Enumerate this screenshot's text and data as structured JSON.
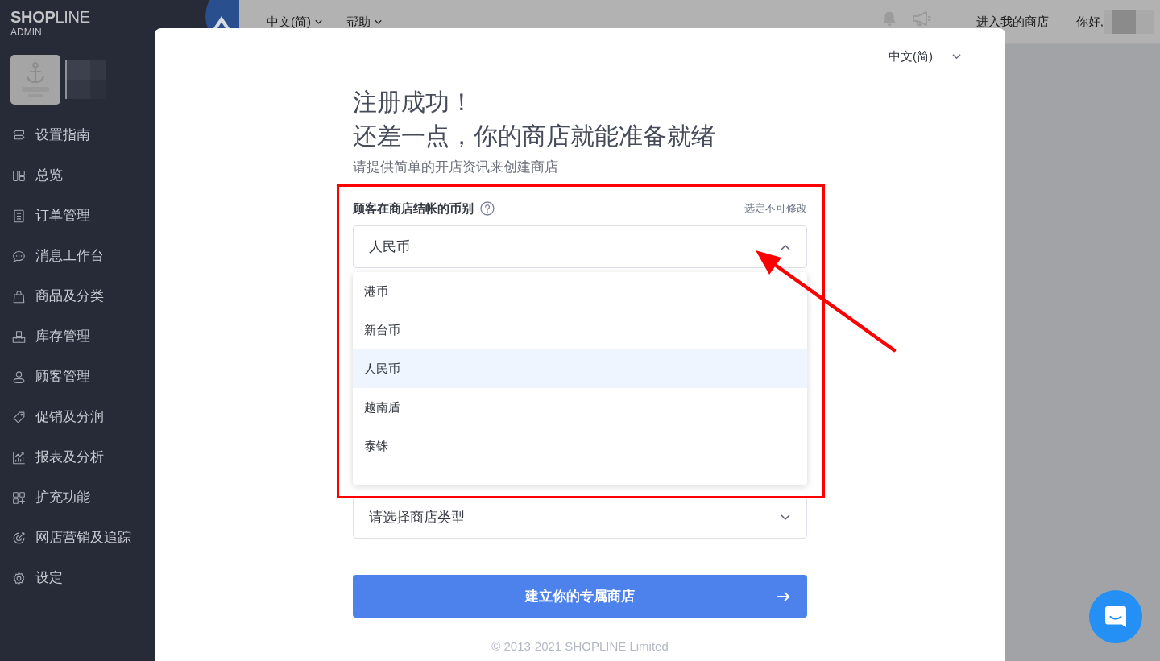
{
  "sidebar": {
    "brand": "**SHOP**LINE",
    "brand_sub": "ADMIN",
    "items": [
      {
        "label": "设置指南"
      },
      {
        "label": "总览"
      },
      {
        "label": "订单管理"
      },
      {
        "label": "消息工作台"
      },
      {
        "label": "商品及分类"
      },
      {
        "label": "库存管理"
      },
      {
        "label": "顾客管理"
      },
      {
        "label": "促销及分润"
      },
      {
        "label": "报表及分析"
      },
      {
        "label": "扩充功能"
      },
      {
        "label": "网店营销及追踪"
      },
      {
        "label": "设定"
      }
    ]
  },
  "header": {
    "language": "中文(简)",
    "help": "帮助",
    "store_link": "进入我的商店",
    "greeting": "你好,"
  },
  "dialog": {
    "language": "中文(简)",
    "title_lines": [
      "注册成功！",
      "还差一点，你的商店就能准备就绪"
    ],
    "subtitle": "请提供简单的开店资讯来创建商店",
    "currency": {
      "label": "顾客在商店结帐的币别",
      "note": "选定不可修改",
      "value": "人民币",
      "expanded": true,
      "options": [
        {
          "label": "港币",
          "selected": false
        },
        {
          "label": "新台币",
          "selected": false
        },
        {
          "label": "人民币",
          "selected": true
        },
        {
          "label": "越南盾",
          "selected": false
        },
        {
          "label": "泰铢",
          "selected": false
        }
      ]
    },
    "store_type": {
      "placeholder": "请选择商店类型"
    },
    "submit": "建立你的专属商店",
    "footer": "© 2013-2021 SHOPLINE Limited"
  }
}
